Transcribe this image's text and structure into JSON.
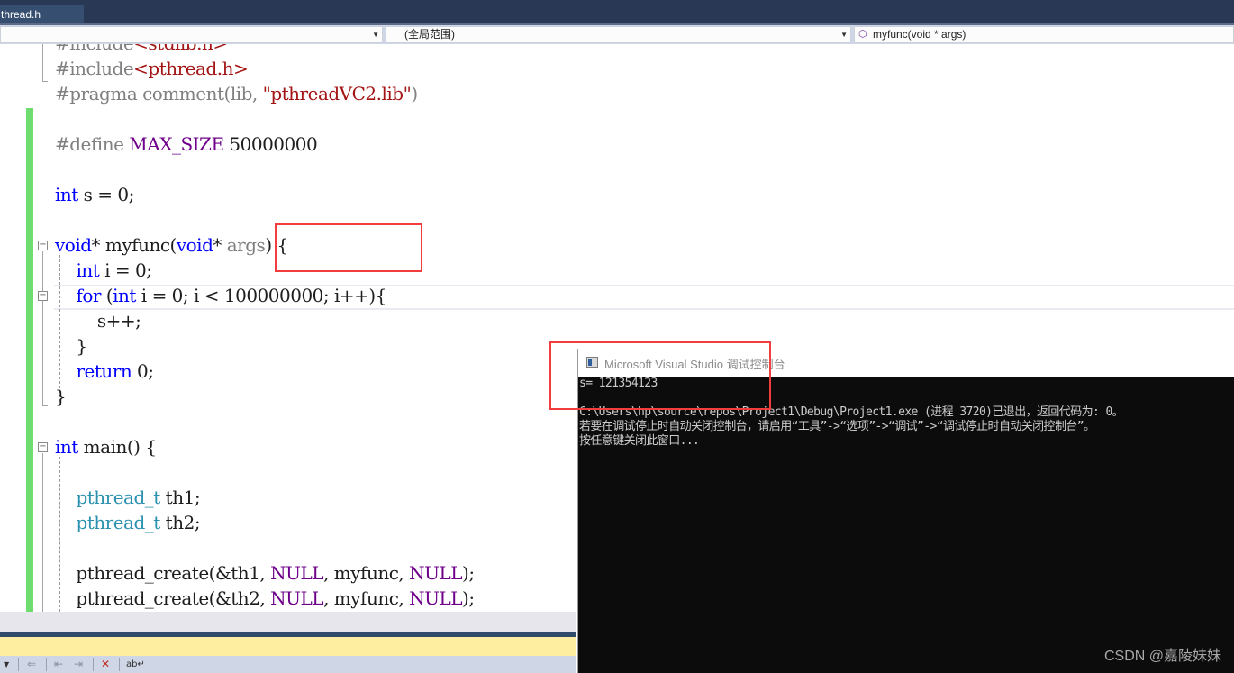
{
  "tab": {
    "label": "thread.h"
  },
  "navbar": {
    "project_value": "",
    "scope_value": "(全局范围)",
    "member_value": "myfunc(void * args)",
    "member_icon": "method-cube-icon"
  },
  "code": {
    "lines": [
      {
        "parts": [
          {
            "t": "#include",
            "c": "pp"
          },
          {
            "t": "<stdlib.h>",
            "c": "str"
          }
        ]
      },
      {
        "parts": [
          {
            "t": "#include",
            "c": "pp"
          },
          {
            "t": "<pthread.h>",
            "c": "str"
          }
        ]
      },
      {
        "parts": [
          {
            "t": "#pragma comment(lib, ",
            "c": "pp"
          },
          {
            "t": "\"pthreadVC2.lib\"",
            "c": "str"
          },
          {
            "t": ")",
            "c": "pp"
          }
        ]
      },
      {
        "parts": []
      },
      {
        "parts": [
          {
            "t": "#define ",
            "c": "pp"
          },
          {
            "t": "MAX_SIZE",
            "c": "mac"
          },
          {
            "t": " 50000000",
            "c": ""
          }
        ]
      },
      {
        "parts": []
      },
      {
        "parts": [
          {
            "t": "int",
            "c": "kw"
          },
          {
            "t": " s = 0;",
            "c": ""
          }
        ]
      },
      {
        "parts": []
      },
      {
        "parts": [
          {
            "t": "void",
            "c": "kw"
          },
          {
            "t": "* myfunc(",
            "c": ""
          },
          {
            "t": "void",
            "c": "kw"
          },
          {
            "t": "* ",
            "c": ""
          },
          {
            "t": "args",
            "c": "pp"
          },
          {
            "t": ") {",
            "c": ""
          }
        ]
      },
      {
        "parts": [
          {
            "t": "    ",
            "c": ""
          },
          {
            "t": "int",
            "c": "kw"
          },
          {
            "t": " i = 0;",
            "c": ""
          }
        ]
      },
      {
        "parts": [
          {
            "t": "    ",
            "c": ""
          },
          {
            "t": "for",
            "c": "kw"
          },
          {
            "t": " (",
            "c": ""
          },
          {
            "t": "int",
            "c": "kw"
          },
          {
            "t": " i = 0; i < 100000000; i++){",
            "c": ""
          }
        ]
      },
      {
        "parts": [
          {
            "t": "        s++;",
            "c": ""
          }
        ]
      },
      {
        "parts": [
          {
            "t": "    }",
            "c": ""
          }
        ]
      },
      {
        "parts": [
          {
            "t": "    ",
            "c": ""
          },
          {
            "t": "return",
            "c": "kw"
          },
          {
            "t": " 0;",
            "c": ""
          }
        ]
      },
      {
        "parts": [
          {
            "t": "}",
            "c": ""
          }
        ]
      },
      {
        "parts": []
      },
      {
        "parts": [
          {
            "t": "int",
            "c": "kw"
          },
          {
            "t": " main() {",
            "c": ""
          }
        ]
      },
      {
        "parts": []
      },
      {
        "parts": [
          {
            "t": "    ",
            "c": ""
          },
          {
            "t": "pthread_t",
            "c": "typ"
          },
          {
            "t": " th1;",
            "c": ""
          }
        ]
      },
      {
        "parts": [
          {
            "t": "    ",
            "c": ""
          },
          {
            "t": "pthread_t",
            "c": "typ"
          },
          {
            "t": " th2;",
            "c": ""
          }
        ]
      },
      {
        "parts": []
      },
      {
        "parts": [
          {
            "t": "    pthread_create(&th1, ",
            "c": ""
          },
          {
            "t": "NULL",
            "c": "mac"
          },
          {
            "t": ", myfunc, ",
            "c": ""
          },
          {
            "t": "NULL",
            "c": "mac"
          },
          {
            "t": ");",
            "c": ""
          }
        ]
      },
      {
        "parts": [
          {
            "t": "    pthread_create(&th2, ",
            "c": ""
          },
          {
            "t": "NULL",
            "c": "mac"
          },
          {
            "t": ", myfunc, ",
            "c": ""
          },
          {
            "t": "NULL",
            "c": "mac"
          },
          {
            "t": ");",
            "c": ""
          }
        ]
      }
    ]
  },
  "console": {
    "title": "Microsoft Visual Studio 调试控制台",
    "lines": [
      "s= 121354123",
      "",
      "C:\\Users\\hp\\source\\repos\\Project1\\Debug\\Project1.exe (进程 3720)已退出，返回代码为: 0。",
      "若要在调试停止时自动关闭控制台，请启用“工具”->“选项”->“调试”->“调试停止时自动关闭控制台”。",
      "按任意键关闭此窗口..."
    ]
  },
  "watermark": "CSDN @嘉陵妹妹",
  "colors": {
    "highlight_box": "#f33c3c",
    "change_bar": "#6fdc6f",
    "tabbar": "#293955"
  }
}
